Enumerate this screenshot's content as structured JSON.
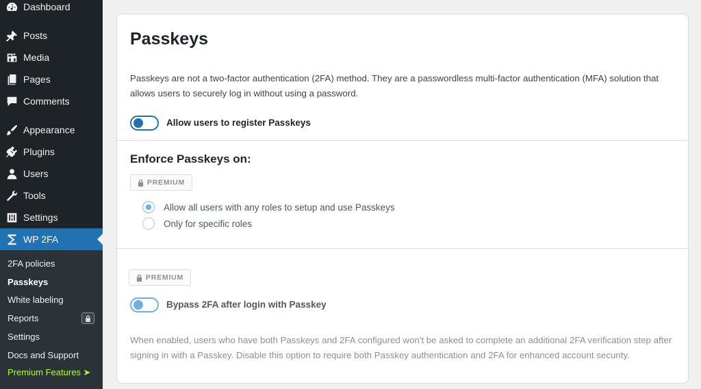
{
  "sidebar": {
    "items": [
      {
        "label": "Dashboard",
        "icon": "dashboard-icon"
      },
      {
        "label": "Posts",
        "icon": "pin-icon"
      },
      {
        "label": "Media",
        "icon": "media-icon"
      },
      {
        "label": "Pages",
        "icon": "pages-icon"
      },
      {
        "label": "Comments",
        "icon": "comment-icon"
      },
      {
        "label": "Appearance",
        "icon": "brush-icon"
      },
      {
        "label": "Plugins",
        "icon": "plugin-icon"
      },
      {
        "label": "Users",
        "icon": "user-icon"
      },
      {
        "label": "Tools",
        "icon": "wrench-icon"
      },
      {
        "label": "Settings",
        "icon": "sliders-icon"
      },
      {
        "label": "WP 2FA",
        "icon": "wp2fa-icon",
        "active": true
      }
    ],
    "submenu": [
      {
        "label": "2FA policies"
      },
      {
        "label": "Passkeys",
        "current": true
      },
      {
        "label": "White labeling"
      },
      {
        "label": "Reports",
        "locked": true
      },
      {
        "label": "Settings"
      },
      {
        "label": "Docs and Support"
      },
      {
        "label": "Premium Features ➤",
        "premium": true
      }
    ]
  },
  "main": {
    "title": "Passkeys",
    "description": "Passkeys are not a two-factor authentication (2FA) method. They are a passwordless multi-factor authentication (MFA) solution that allows users to securely log in without using a password.",
    "allow_toggle": {
      "label": "Allow users to register Passkeys",
      "on": true
    },
    "enforce": {
      "title": "Enforce Passkeys on:",
      "badge": "PREMIUM",
      "options": [
        {
          "label": "Allow all users with any roles to setup and use Passkeys",
          "checked": true
        },
        {
          "label": "Only for specific roles",
          "checked": false
        }
      ]
    },
    "bypass": {
      "badge": "PREMIUM",
      "label": "Bypass 2FA after login with Passkey",
      "on": true,
      "note": "When enabled, users who have both Passkeys and 2FA configured won't be asked to complete an additional 2FA verification step after signing in with a Passkey. Disable this option to require both Passkey authentication and 2FA for enhanced account security."
    }
  },
  "colors": {
    "sidebar_bg": "#1d2327",
    "submenu_bg": "#2c3338",
    "accent": "#2271b1",
    "premium_link": "#aaff33"
  }
}
